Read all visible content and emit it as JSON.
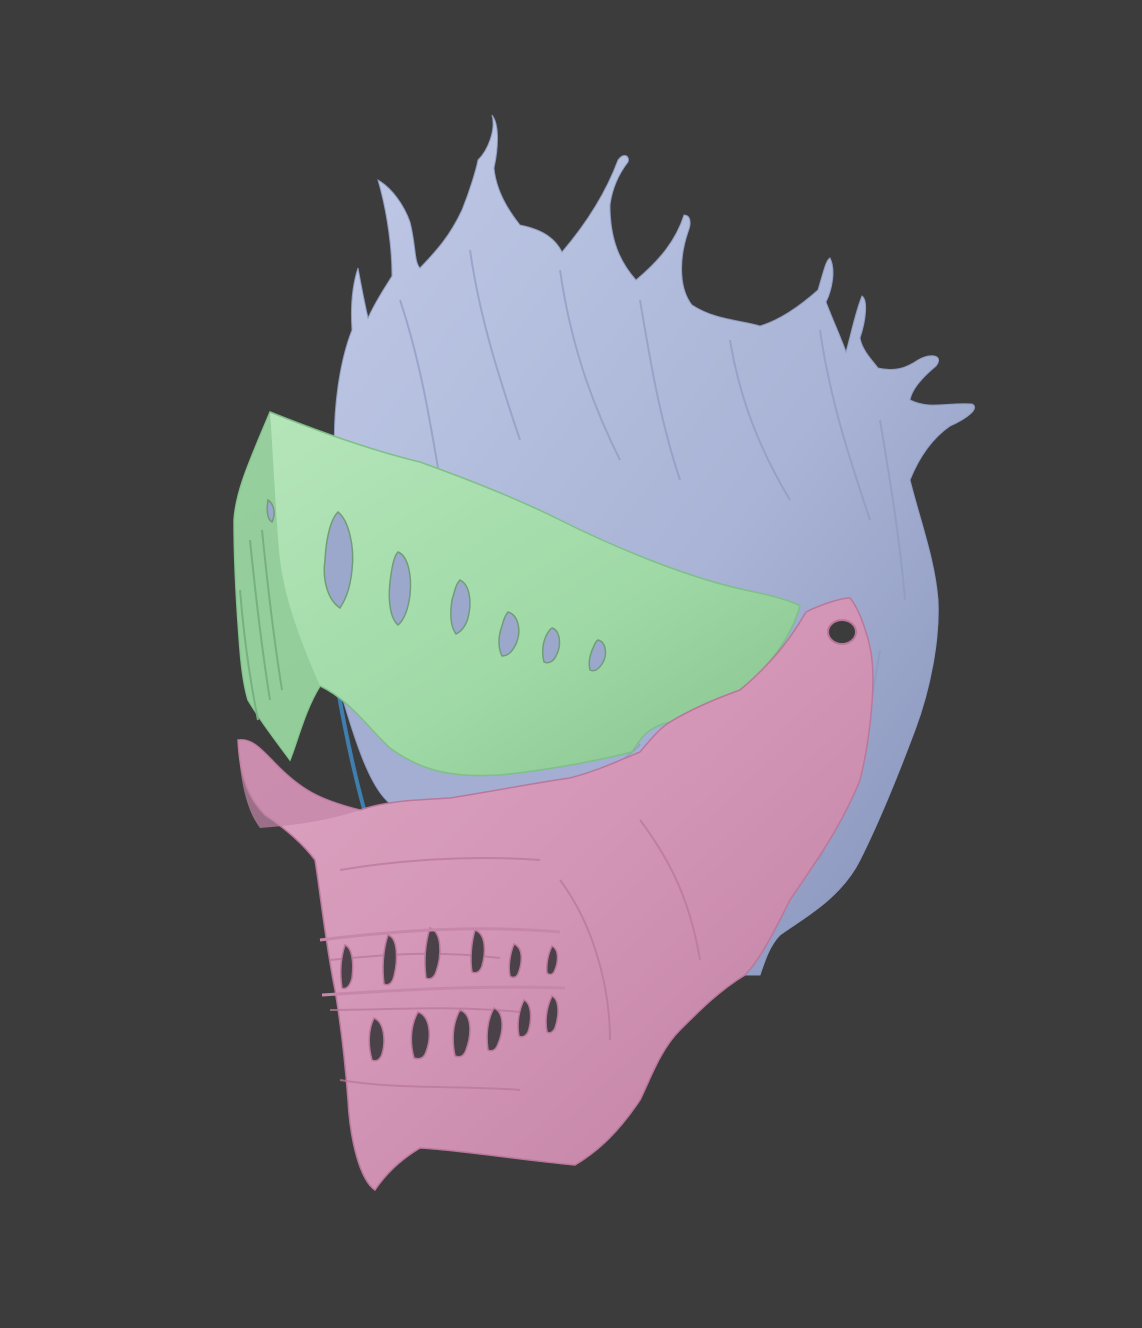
{
  "viewport": {
    "background": "#3c3c3c"
  },
  "mesh_parts": [
    {
      "name": "hood-flames",
      "color": "#a9b4d6",
      "shade": "#8e9ac0",
      "highlight": "#c4cce6"
    },
    {
      "name": "visor",
      "color": "#9fd9a6",
      "shade": "#7fbf88",
      "highlight": "#b9e8bd"
    },
    {
      "name": "jaw-guard",
      "color": "#d395b6",
      "shade": "#b9789b",
      "highlight": "#e6b0cb"
    },
    {
      "name": "hinge-strip",
      "color": "#3f7fb0"
    }
  ]
}
